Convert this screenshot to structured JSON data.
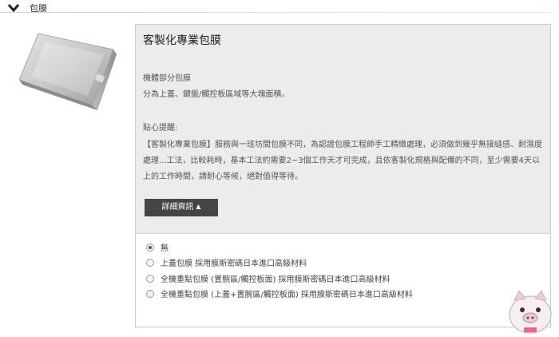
{
  "section": {
    "title": "包膜"
  },
  "product": {
    "title": "客製化專業包膜",
    "line1": "機體部分包膜",
    "line2": "分為上蓋、鍵盤/觸控板區域等大塊面積。",
    "tip_label": "貼心提醒:",
    "tip_text": "【客製化專業包膜】服務與一班坊間包膜不同，為認證包膜工程師手工精緻處理，必須做到幾乎無接縫感、耐濕度處理...工法，比較耗時，基本工法約需要2~3個工作天才可完成，且依客製化規格與配備的不同，至少需要4天以上的工作時間，請耐心等候，絕對值得等待。",
    "more_button": "詳細資訊",
    "more_arrow": "▲"
  },
  "options": [
    {
      "label": "無",
      "checked": true
    },
    {
      "label": "上蓋包膜 採用膜斯密碼日本進口高級材料",
      "checked": false
    },
    {
      "label": "全機重點包膜 (置腕區/觸控板面) 採用膜斯密碼日本進口高級材料",
      "checked": false
    },
    {
      "label": "全機重點包膜 (上蓋+置腕區/觸控板面) 採用膜斯密碼日本進口高級材料",
      "checked": false
    }
  ]
}
